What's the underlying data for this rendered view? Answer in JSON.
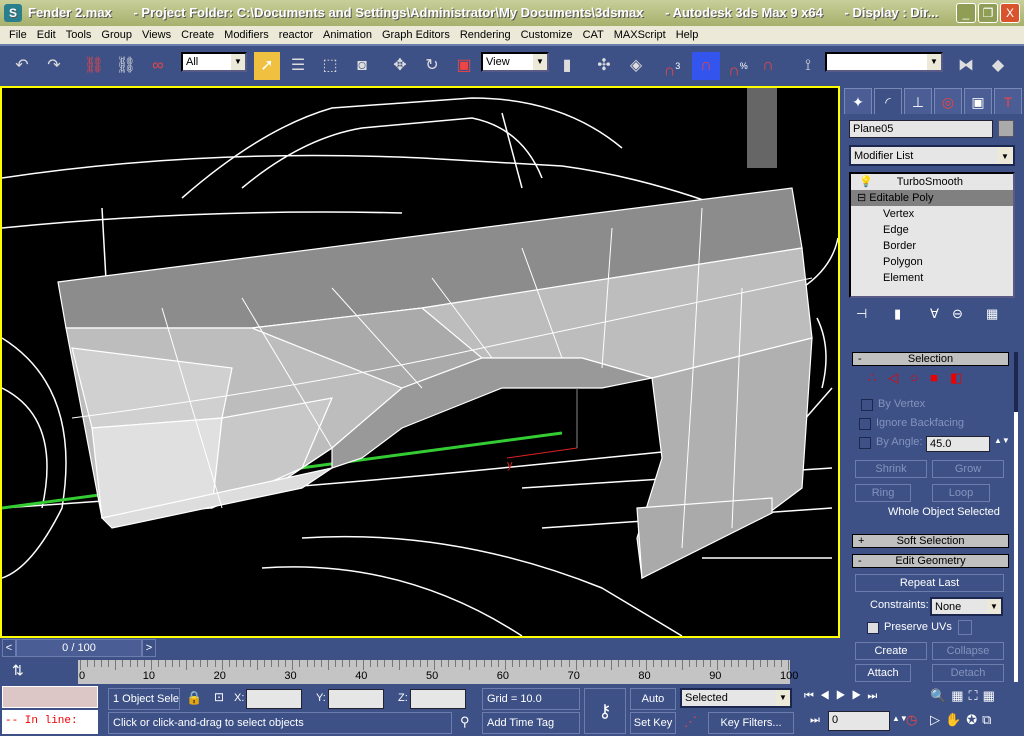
{
  "window": {
    "title": "Fender 2.max      - Project Folder: C:\\Documents and Settings\\Administrator\\My Documents\\3dsmax      - Autodesk 3ds Max 9 x64      - Display : Dir...",
    "minimize": "_",
    "restore": "❐",
    "close": "X"
  },
  "menu": [
    "File",
    "Edit",
    "Tools",
    "Group",
    "Views",
    "Create",
    "Modifiers",
    "reactor",
    "Animation",
    "Graph Editors",
    "Rendering",
    "Customize",
    "CAT",
    "MAXScript",
    "Help"
  ],
  "toolbar": {
    "selection_filter": "All",
    "reference_coord": "View",
    "named_selection": "",
    "snap_label": "3",
    "percent_snap": "%"
  },
  "viewport": {
    "axis_y": "y",
    "border_color": "#ffff00"
  },
  "command_panel": {
    "tabs": [
      "create",
      "modify",
      "hierarchy",
      "motion",
      "display",
      "utilities"
    ],
    "object_name": "Plane05",
    "modifier_list": "Modifier List",
    "stack": {
      "modifier": "TurboSmooth",
      "base": "Editable Poly",
      "subobjects": [
        "Vertex",
        "Edge",
        "Border",
        "Polygon",
        "Element"
      ]
    },
    "selection": {
      "header": "Selection",
      "collapse": "-",
      "by_vertex": "By Vertex",
      "ignore_backfacing": "Ignore Backfacing",
      "by_angle": "By Angle:",
      "angle_value": "45.0",
      "shrink": "Shrink",
      "grow": "Grow",
      "ring": "Ring",
      "loop": "Loop",
      "status": "Whole Object Selected"
    },
    "soft_selection": {
      "header": "Soft Selection",
      "expand": "+"
    },
    "edit_geometry": {
      "header": "Edit Geometry",
      "collapse": "-",
      "repeat_last": "Repeat Last",
      "constraints_label": "Constraints:",
      "constraints_value": "None",
      "preserve_uvs": "Preserve UVs",
      "create": "Create",
      "collapse_btn": "Collapse",
      "attach": "Attach",
      "detach": "Detach"
    }
  },
  "timeline": {
    "frame": "0 / 100",
    "prev": "<",
    "next": ">",
    "ticks": [
      "0",
      "10",
      "20",
      "30",
      "40",
      "50",
      "60",
      "70",
      "80",
      "90",
      "100"
    ]
  },
  "status": {
    "script_line": "-- In line:",
    "selection_count": "1 Object Sele",
    "x_label": "X:",
    "y_label": "Y:",
    "z_label": "Z:",
    "x": "",
    "y": "",
    "z": "",
    "grid": "Grid = 10.0",
    "prompt": "Click or click-and-drag to select objects",
    "add_time_tag": "Add Time Tag",
    "auto_key": "Auto Key",
    "set_key": "Set Key",
    "key_mode": "Selected",
    "key_filters": "Key Filters...",
    "current_frame": "0"
  }
}
